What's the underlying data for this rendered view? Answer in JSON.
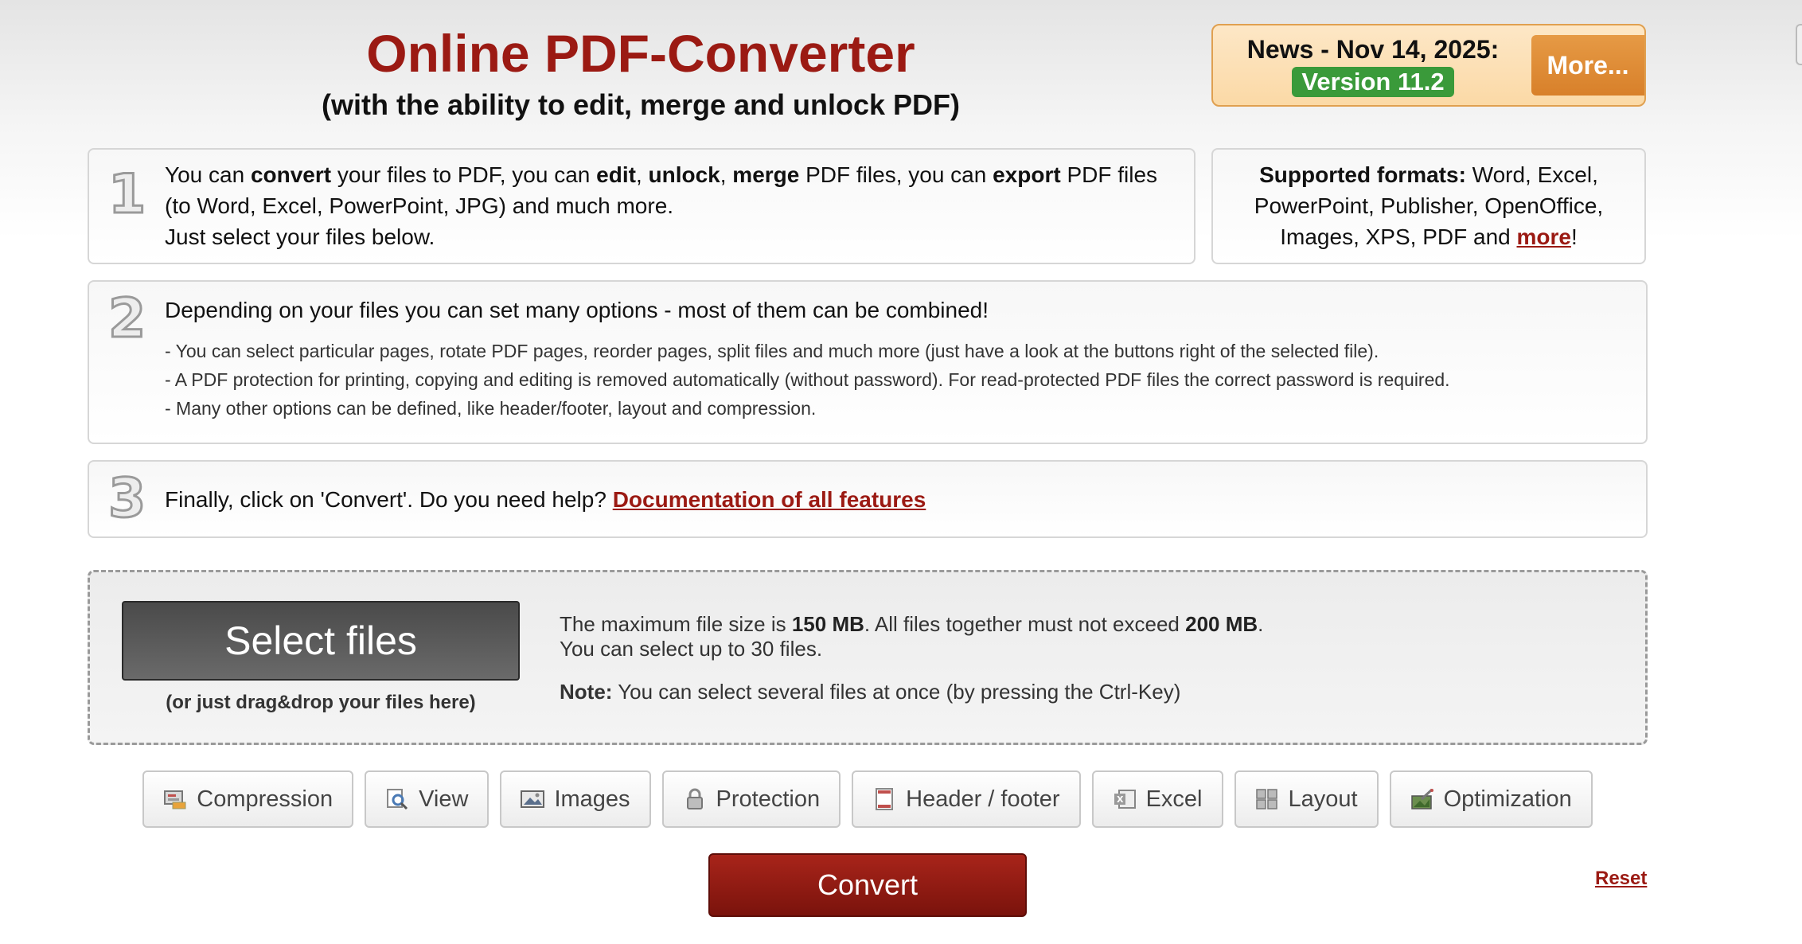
{
  "header": {
    "title": "Online PDF-Converter",
    "subtitle": "(with the ability to edit, merge and unlock PDF)"
  },
  "news": {
    "date": "News - Nov 14, 2025:",
    "version": "Version 11.2",
    "more_label": "More..."
  },
  "step1": {
    "number": "1",
    "t1": "You can ",
    "b1": "convert",
    "t2": " your files to PDF, you can ",
    "b2": "edit",
    "t3": ", ",
    "b3": "unlock",
    "t4": ", ",
    "b4": "merge",
    "t5": " PDF files, you can ",
    "b5": "export",
    "t6": " PDF files (to Word, Excel, PowerPoint, JPG) and much more.",
    "line2": "Just select your files below."
  },
  "formats": {
    "label": "Supported formats:",
    "text": " Word, Excel, PowerPoint, Publisher, OpenOffice, Images, XPS, PDF and ",
    "more_link": "more",
    "end": "!"
  },
  "step2": {
    "number": "2",
    "heading": "Depending on your files you can set many options - most of them can be combined!",
    "items": [
      "- You can select particular pages, rotate PDF pages, reorder pages, split files and much more (just have a look at the buttons right of the selected file).",
      "- A PDF protection for printing, copying and editing is removed automatically (without password). For read-protected PDF files the correct password is required.",
      "- Many other options can be defined, like header/footer, layout and compression."
    ]
  },
  "step3": {
    "number": "3",
    "text": "Finally, click on 'Convert'. Do you need help? ",
    "link": "Documentation of all features"
  },
  "upload": {
    "button_label": "Select files",
    "drag_hint": "(or just drag&drop your files here)",
    "max_t1": "The maximum file size is ",
    "max_b1": "150 MB",
    "max_t2": ". All files together must not exceed ",
    "max_b2": "200 MB",
    "max_t3": ".",
    "count_text": "You can select up to 30 files.",
    "note_label": "Note:",
    "note_text": " You can select several files at once (by pressing the Ctrl-Key)"
  },
  "options": [
    {
      "label": "Compression",
      "icon": "compression-icon"
    },
    {
      "label": "View",
      "icon": "view-icon"
    },
    {
      "label": "Images",
      "icon": "images-icon"
    },
    {
      "label": "Protection",
      "icon": "protection-icon"
    },
    {
      "label": "Header / footer",
      "icon": "header-footer-icon"
    },
    {
      "label": "Excel",
      "icon": "excel-icon"
    },
    {
      "label": "Layout",
      "icon": "layout-icon"
    },
    {
      "label": "Optimization",
      "icon": "optimization-icon"
    }
  ],
  "actions": {
    "convert_label": "Convert",
    "reset_label": "Reset"
  },
  "colors": {
    "brand_red": "#9b1a13",
    "version_green": "#3a9a3a",
    "more_orange": "#e69a45"
  }
}
